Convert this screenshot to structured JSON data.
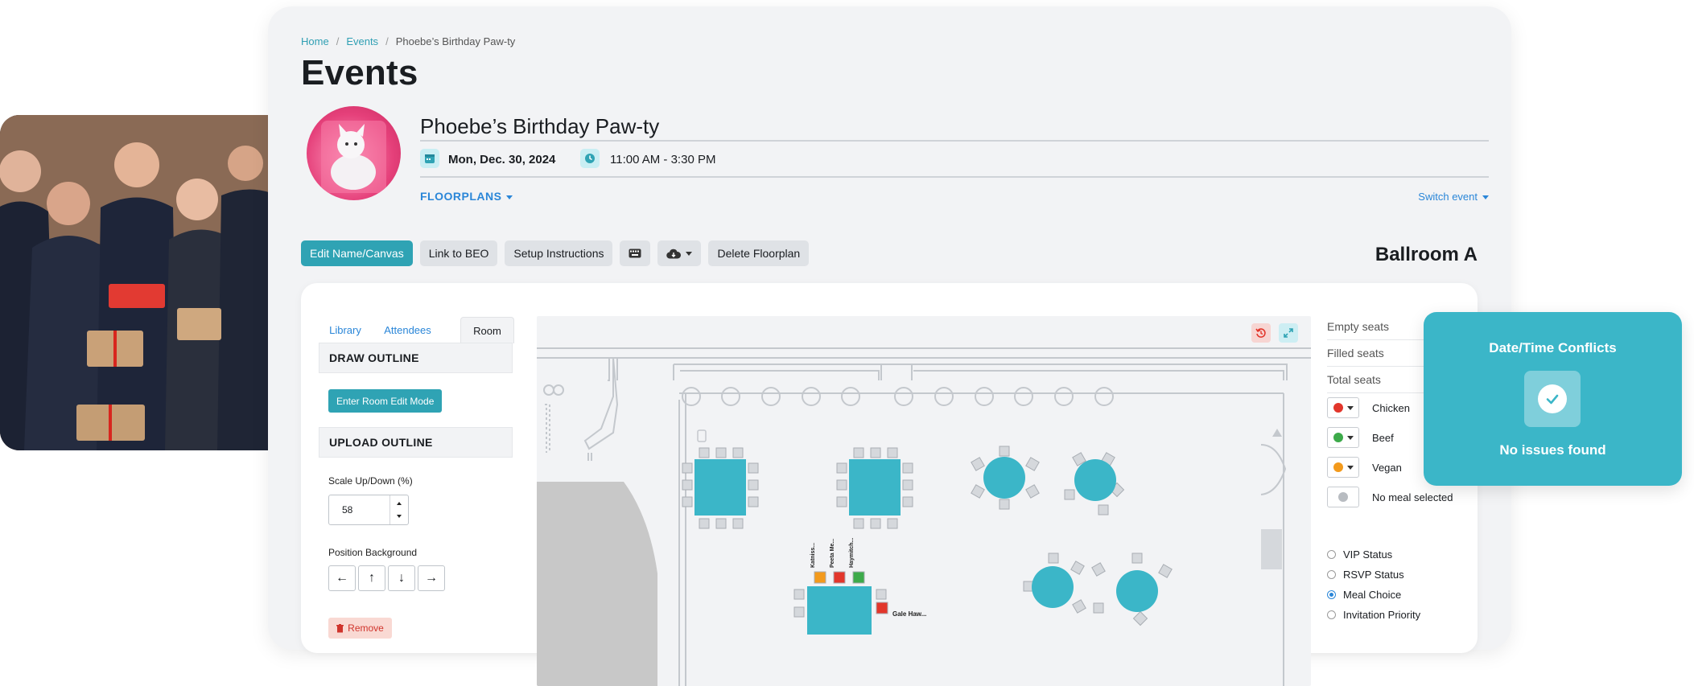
{
  "breadcrumb": {
    "home": "Home",
    "events": "Events",
    "current": "Phoebe’s Birthday Paw-ty"
  },
  "page_title": "Events",
  "event": {
    "name": "Phoebe’s Birthday Paw-ty",
    "date": "Mon, Dec. 30, 2024",
    "time": "11:00 AM - 3:30 PM",
    "floorplans_label": "FLOORPLANS",
    "switch_label": "Switch event"
  },
  "toolbar": {
    "edit": "Edit Name/Canvas",
    "link_beo": "Link to BEO",
    "setup": "Setup Instructions",
    "keyboard_icon": "keyboard-icon",
    "cloud_icon": "cloud-download-icon",
    "delete": "Delete Floorplan"
  },
  "room_name": "Ballroom A",
  "panel": {
    "tabs": [
      "Library",
      "Attendees",
      "Room"
    ],
    "active_tab": "Room",
    "draw_outline": "DRAW OUTLINE",
    "enter_edit": "Enter Room Edit Mode",
    "upload_outline": "UPLOAD OUTLINE",
    "scale_label": "Scale Up/Down (%)",
    "scale_value": "58",
    "position_label": "Position Background",
    "arrows": [
      "←",
      "↑",
      "↓",
      "→"
    ],
    "remove": "Remove"
  },
  "canvas": {
    "seat_labels": [
      "Katniss...",
      "Peeta Me...",
      "Haymitch..."
    ],
    "guest_label": "Gale Haw..."
  },
  "stats": {
    "empty": "Empty seats",
    "filled": "Filled seats",
    "total": "Total seats"
  },
  "meals": [
    {
      "label": "Chicken",
      "color": "#e2362b"
    },
    {
      "label": "Beef",
      "color": "#3daa4a"
    },
    {
      "label": "Vegan",
      "color": "#f39a1c"
    },
    {
      "label": "No meal selected",
      "color": "#b8bcc1"
    }
  ],
  "color_by": {
    "options": [
      "VIP Status",
      "RSVP Status",
      "Meal Choice",
      "Invitation Priority"
    ],
    "selected": "Meal Choice"
  },
  "conflicts": {
    "title": "Date/Time Conflicts",
    "message": "No issues found"
  },
  "colors": {
    "accent": "#2fa3b4",
    "link": "#2a86d8",
    "table": "#3bb6c8"
  }
}
